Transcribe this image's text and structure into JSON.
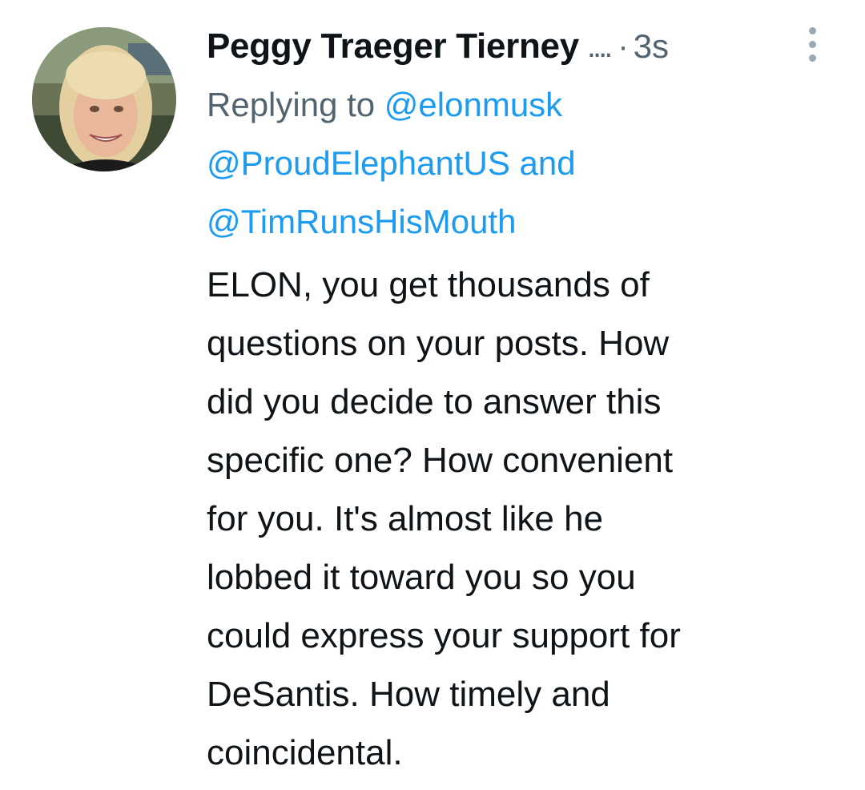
{
  "tweet": {
    "author_name": "Peggy Traeger Tierney",
    "name_truncation": "....",
    "separator": "·",
    "timestamp": "3s",
    "more_icon": "vertical-dots-icon",
    "avatar_icon": "profile-photo",
    "replying": {
      "prefix": "Replying to",
      "mention_1": "@elonmusk",
      "mention_2": "@ProudElephantUS",
      "conjunction": "and",
      "mention_3": "@TimRunsHisMouth"
    },
    "body_lines": [
      "ELON, you get thousands of",
      "questions on your posts. How",
      "did you decide to answer this",
      "specific one? How convenient",
      "for you. It's almost like he",
      "lobbed it toward you so you",
      "could express your support for",
      "DeSantis. How timely and",
      "coincidental."
    ],
    "colors": {
      "text": "#0f1419",
      "secondary": "#536471",
      "link": "#1d9bf0"
    }
  }
}
